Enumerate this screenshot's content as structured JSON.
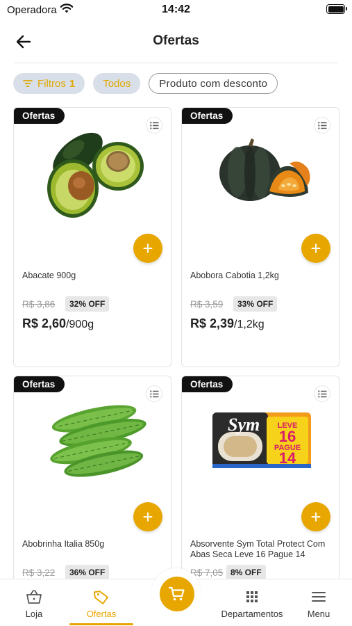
{
  "status_bar": {
    "carrier": "Operadora",
    "time": "14:42"
  },
  "header": {
    "title": "Ofertas"
  },
  "filters": {
    "filters_label": "Filtros",
    "filters_count": "1",
    "all_label": "Todos",
    "discount_label": "Produto com desconto"
  },
  "products": [
    {
      "tag": "Ofertas",
      "name": "Abacate 900g",
      "old_price": "R$ 3,86",
      "discount": "32% OFF",
      "price": "R$ 2,60",
      "unit": "/900g",
      "image": "avocado"
    },
    {
      "tag": "Ofertas",
      "name": "Abobora Cabotia 1,2kg",
      "old_price": "R$ 3,59",
      "discount": "33% OFF",
      "price": "R$ 2,39",
      "unit": "/1,2kg",
      "image": "pumpkin"
    },
    {
      "tag": "Ofertas",
      "name": "Abobrinha Italia 850g",
      "old_price": "R$ 3,22",
      "discount": "36% OFF",
      "price": "",
      "unit": "",
      "image": "zucchini"
    },
    {
      "tag": "Ofertas",
      "name": "Absorvente Sym Total Protect Com Abas Seca Leve 16 Pague 14",
      "old_price": "R$ 7,05",
      "discount": "8% OFF",
      "price": "",
      "unit": "",
      "image": "sym-pack"
    }
  ],
  "sym_pack": {
    "brand": "Sym",
    "leve": "LEVE",
    "leve_n": "16",
    "pague": "PAGUE",
    "pague_n": "14"
  },
  "bottom_nav": {
    "store": "Loja",
    "offers": "Ofertas",
    "departments": "Departamentos",
    "menu": "Menu"
  },
  "colors": {
    "accent": "#e8a600",
    "chip_bg": "#d9dfe8",
    "tag_bg": "#111111"
  }
}
